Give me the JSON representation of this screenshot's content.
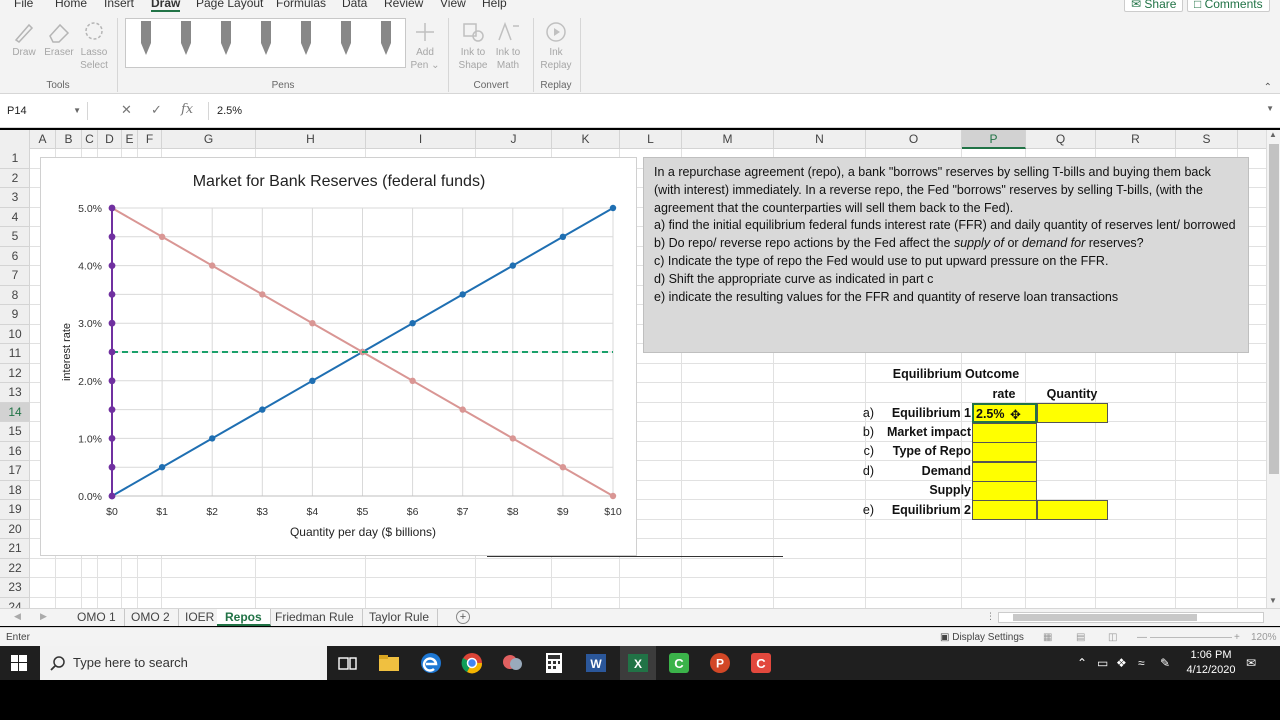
{
  "menu": {
    "tabs": [
      "File",
      "Home",
      "Insert",
      "Draw",
      "Page Layout",
      "Formulas",
      "Data",
      "Review",
      "View",
      "Help"
    ],
    "active_tab": "Draw",
    "share": "Share",
    "comments": "Comments"
  },
  "ribbon": {
    "tools": {
      "draw": "Draw",
      "eraser": "Eraser",
      "lasso1": "Lasso",
      "lasso2": "Select",
      "group": "Tools"
    },
    "pens_group": "Pens",
    "add_pen1": "Add",
    "add_pen2": "Pen ⌄",
    "convert": {
      "ink_shape1": "Ink to",
      "ink_shape2": "Shape",
      "ink_math1": "Ink to",
      "ink_math2": "Math",
      "group": "Convert"
    },
    "replay": {
      "ink_replay1": "Ink",
      "ink_replay2": "Replay",
      "group": "Replay"
    }
  },
  "formula_bar": {
    "name_box": "P14",
    "formula": "2.5%"
  },
  "columns": [
    "A",
    "B",
    "C",
    "D",
    "E",
    "F",
    "G",
    "H",
    "I",
    "J",
    "K",
    "L",
    "M",
    "N",
    "O",
    "P",
    "Q",
    "R",
    "S"
  ],
  "rows": [
    "1",
    "2",
    "3",
    "4",
    "5",
    "6",
    "7",
    "8",
    "9",
    "10",
    "11",
    "12",
    "13",
    "14",
    "15",
    "16",
    "17",
    "18",
    "19",
    "20",
    "21",
    "22",
    "23",
    "24"
  ],
  "chart_data": {
    "type": "line",
    "title": "Market for Bank Reserves (federal funds)",
    "xlabel": "Quantity per day ($ billions)",
    "ylabel": "interest rate",
    "x": [
      "$0",
      "$1",
      "$2",
      "$3",
      "$4",
      "$5",
      "$6",
      "$7",
      "$8",
      "$9",
      "$10"
    ],
    "y_ticks": [
      "0.0%",
      "1.0%",
      "2.0%",
      "3.0%",
      "4.0%",
      "5.0%"
    ],
    "ylim": [
      0,
      5.0
    ],
    "series": [
      {
        "values": [
          0,
          0.5,
          1.0,
          1.5,
          2.0,
          2.5,
          3.0,
          3.5,
          4.0,
          4.5,
          5.0
        ],
        "color": "#1f6fb2"
      },
      {
        "values": [
          5.0,
          4.5,
          4.0,
          3.5,
          3.0,
          2.5,
          2.0,
          1.5,
          1.0,
          0.5,
          0
        ],
        "color": "#d99694"
      },
      {
        "values": [
          2.5,
          2.5,
          2.5,
          2.5,
          2.5,
          2.5,
          2.5,
          2.5,
          2.5,
          2.5,
          2.5
        ],
        "color": "#1aa06a",
        "dashed": true
      },
      {
        "vertical_at_x": 0,
        "values": [
          0,
          0.5,
          1.0,
          1.5,
          2.0,
          2.5,
          3.0,
          3.5,
          4.0,
          4.5,
          5.0
        ],
        "color": "#7030a0"
      }
    ],
    "grid": true
  },
  "textbox": {
    "p1": "In a repurchase agreement (repo), a bank \"borrows\" reserves by selling T-bills and buying them back (with interest) immediately. In a reverse repo, the Fed \"borrows\" reserves by selling T-bills, (with the agreement that the counterparties will sell them back to the Fed).",
    "p2": "a) find the initial equilibrium federal funds interest rate (FFR) and daily quantity of reserves lent/ borrowed",
    "p3a": "b) Do repo/ reverse repo actions by the Fed affect the ",
    "p3b": "supply of",
    "p3c": " or ",
    "p3d": "demand for",
    "p3e": " reserves?",
    "p4": "c) Indicate the type of repo the Fed would use to put upward pressure on the FFR.",
    "p5": "d) Shift the appropriate curve as indicated in part c",
    "p6": "e) indicate the resulting values for the FFR and quantity of reserve loan transactions"
  },
  "table": {
    "title": "Equilibrium Outcome",
    "rate_hdr": "rate",
    "qty_hdr": "Quantity",
    "rows": [
      {
        "letter": "a)",
        "label": "Equilibrium 1",
        "rate": "2.5%"
      },
      {
        "letter": "b)",
        "label": "Market impact",
        "rate": ""
      },
      {
        "letter": "c)",
        "label": "Type of Repo",
        "rate": ""
      },
      {
        "letter": "d)",
        "label": "Demand",
        "rate": ""
      },
      {
        "letter": "",
        "label": "Supply",
        "rate": ""
      },
      {
        "letter": "e)",
        "label": "Equilibrium 2",
        "rate": ""
      }
    ]
  },
  "sheets": [
    "OMO 1",
    "OMO 2",
    "IOER",
    "Repos",
    "Friedman Rule",
    "Taylor Rule"
  ],
  "active_sheet": "Repos",
  "status": {
    "mode": "Enter",
    "display_settings": "Display Settings",
    "zoom": "120%"
  },
  "taskbar": {
    "search_placeholder": "Type here to search",
    "time": "1:06 PM",
    "date": "4/12/2020"
  }
}
